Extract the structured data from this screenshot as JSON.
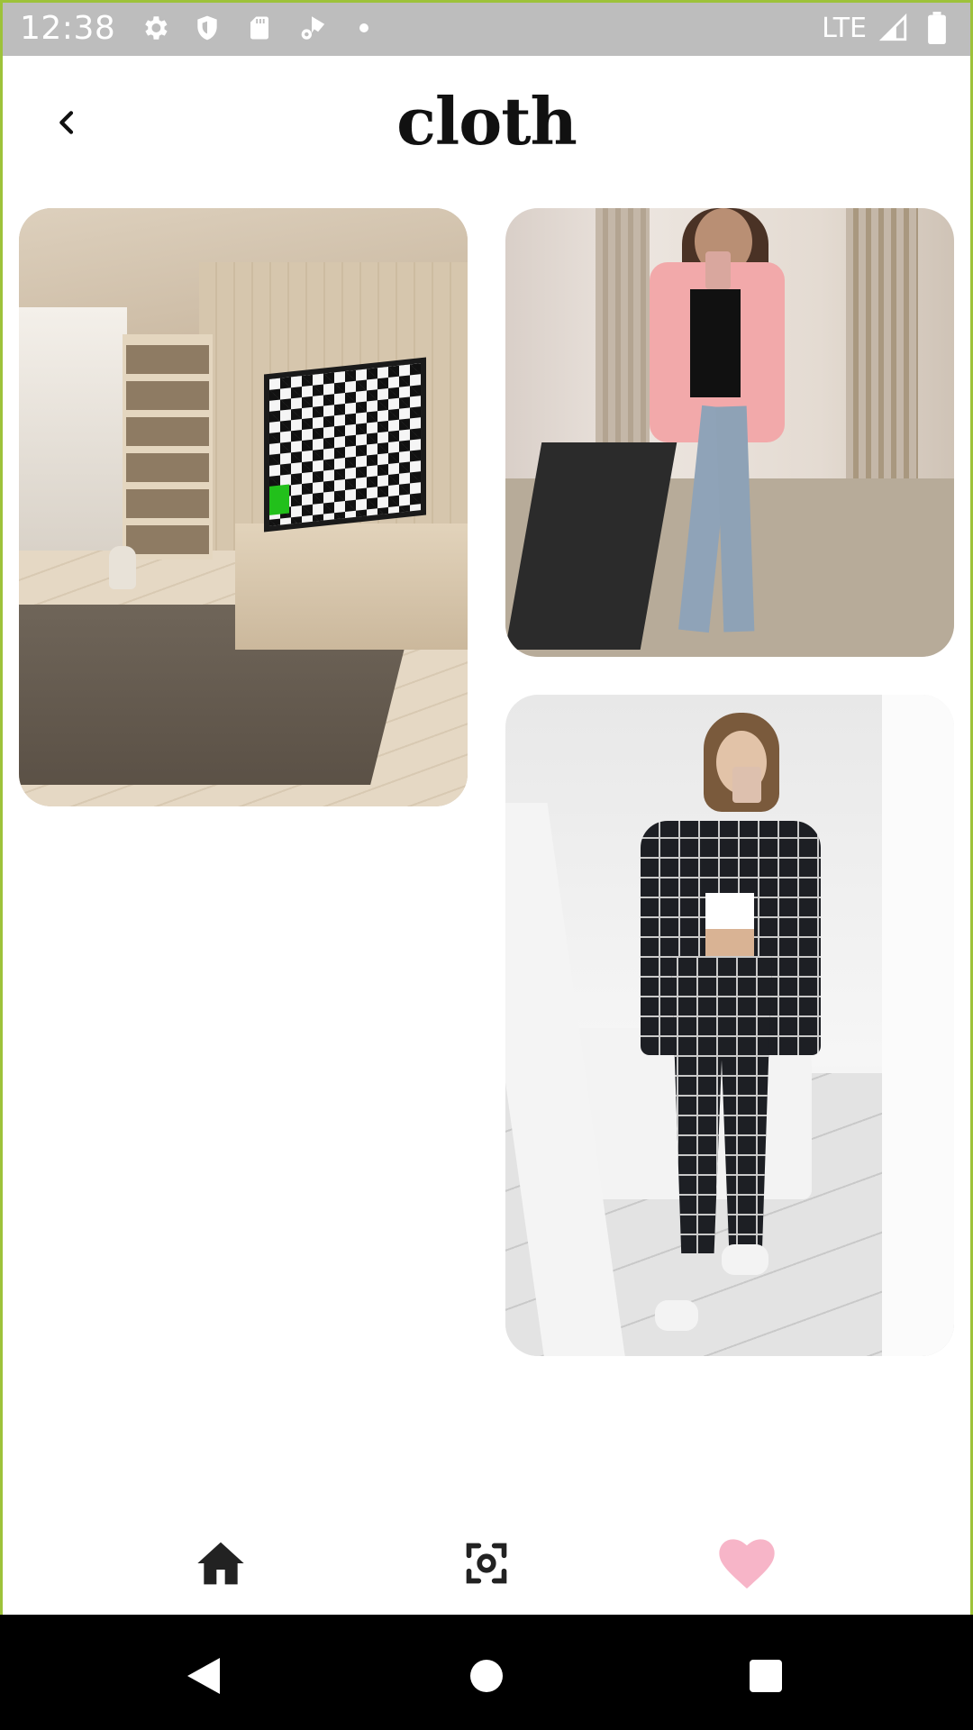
{
  "status_bar": {
    "time": "12:38",
    "network": "LTE",
    "icons": [
      "settings-icon",
      "shield-icon",
      "sd-card-icon",
      "wifi-settings-icon",
      "dot-icon",
      "signal-icon",
      "battery-icon"
    ]
  },
  "header": {
    "title": "cloth",
    "back_icon": "chevron-left-icon"
  },
  "gallery": {
    "items": [
      {
        "subject": "room-with-tv"
      },
      {
        "subject": "pink-blazer-outfit"
      },
      {
        "subject": "plaid-suit-outfit"
      }
    ]
  },
  "bottom_nav": {
    "items": [
      {
        "icon": "home-icon",
        "active": false
      },
      {
        "icon": "scan-icon",
        "active": false
      },
      {
        "icon": "heart-icon",
        "active": true
      }
    ],
    "active_color": "#f7b5c8",
    "inactive_color": "#222222"
  },
  "system_nav": {
    "items": [
      "back-triangle-icon",
      "home-circle-icon",
      "recents-square-icon"
    ]
  },
  "colors": {
    "status_bar": "#bdbdbd",
    "frame": "#9dc23a",
    "background": "#ffffff"
  }
}
